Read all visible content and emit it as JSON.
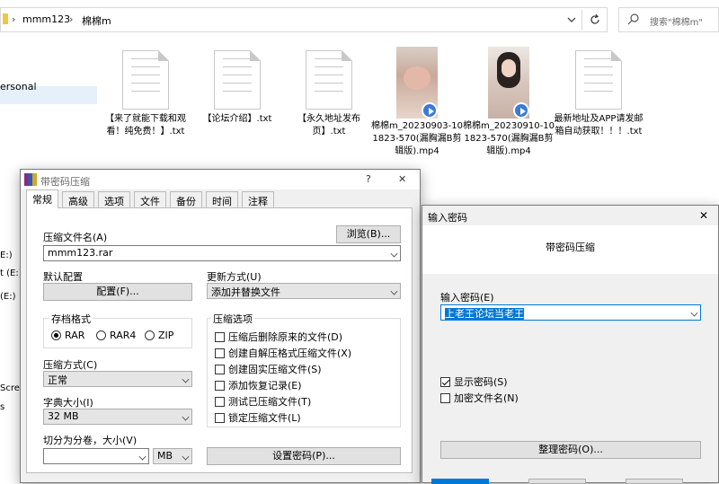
{
  "explorer": {
    "breadcrumb": [
      "mmm123",
      "棉棉m"
    ],
    "search_placeholder": "搜索\"棉棉m\"",
    "nav_items": [
      "ersonal",
      "E:)",
      "t (E:)",
      "(E:)",
      "Scre",
      "s"
    ],
    "files": [
      {
        "name": "【来了就能下载和观看！纯免费！】.txt",
        "type": "txt"
      },
      {
        "name": "【论坛介绍】.txt",
        "type": "txt"
      },
      {
        "name": "【永久地址发布页】.txt",
        "type": "txt"
      },
      {
        "name": "棉棉m_20230903-101823-570(漏胸漏B剪辑版).mp4",
        "type": "mp4"
      },
      {
        "name": "棉棉m_20230910-101823-570(漏胸漏B剪辑版).mp4",
        "type": "mp4"
      },
      {
        "name": "最新地址及APP请发邮箱自动获取！！！.txt",
        "type": "txt"
      }
    ]
  },
  "archive_dialog": {
    "title": "带密码压缩",
    "help": "?",
    "close": "✕",
    "tabs": [
      "常规",
      "高级",
      "选项",
      "文件",
      "备份",
      "时间",
      "注释"
    ],
    "archive_name_label": "压缩文件名(A)",
    "archive_name_value": "mmm123.rar",
    "browse_button": "浏览(B)...",
    "default_config_label": "默认配置",
    "config_button": "配置(F)...",
    "update_mode_label": "更新方式(U)",
    "update_mode_value": "添加并替换文件",
    "format_group": "存档格式",
    "formats": [
      "RAR",
      "RAR4",
      "ZIP"
    ],
    "compression_options_group": "压缩选项",
    "options": [
      "压缩后删除原来的文件(D)",
      "创建自解压格式压缩文件(X)",
      "创建固实压缩文件(S)",
      "添加恢复记录(E)",
      "测试已压缩文件(T)",
      "锁定压缩文件(L)"
    ],
    "method_label": "压缩方式(C)",
    "method_value": "正常",
    "dict_label": "字典大小(I)",
    "dict_value": "32 MB",
    "split_label": "切分为分卷，大小(V)",
    "split_value": "",
    "split_unit": "MB",
    "set_password_button": "设置密码(P)..."
  },
  "password_dialog": {
    "title": "输入密码",
    "close": "✕",
    "heading": "带密码压缩",
    "enter_label": "输入密码(E)",
    "password_value": "上老王论坛当老王",
    "show_password": "显示密码(S)",
    "encrypt_names": "加密文件名(N)",
    "organize_button": "整理密码(O)..."
  }
}
